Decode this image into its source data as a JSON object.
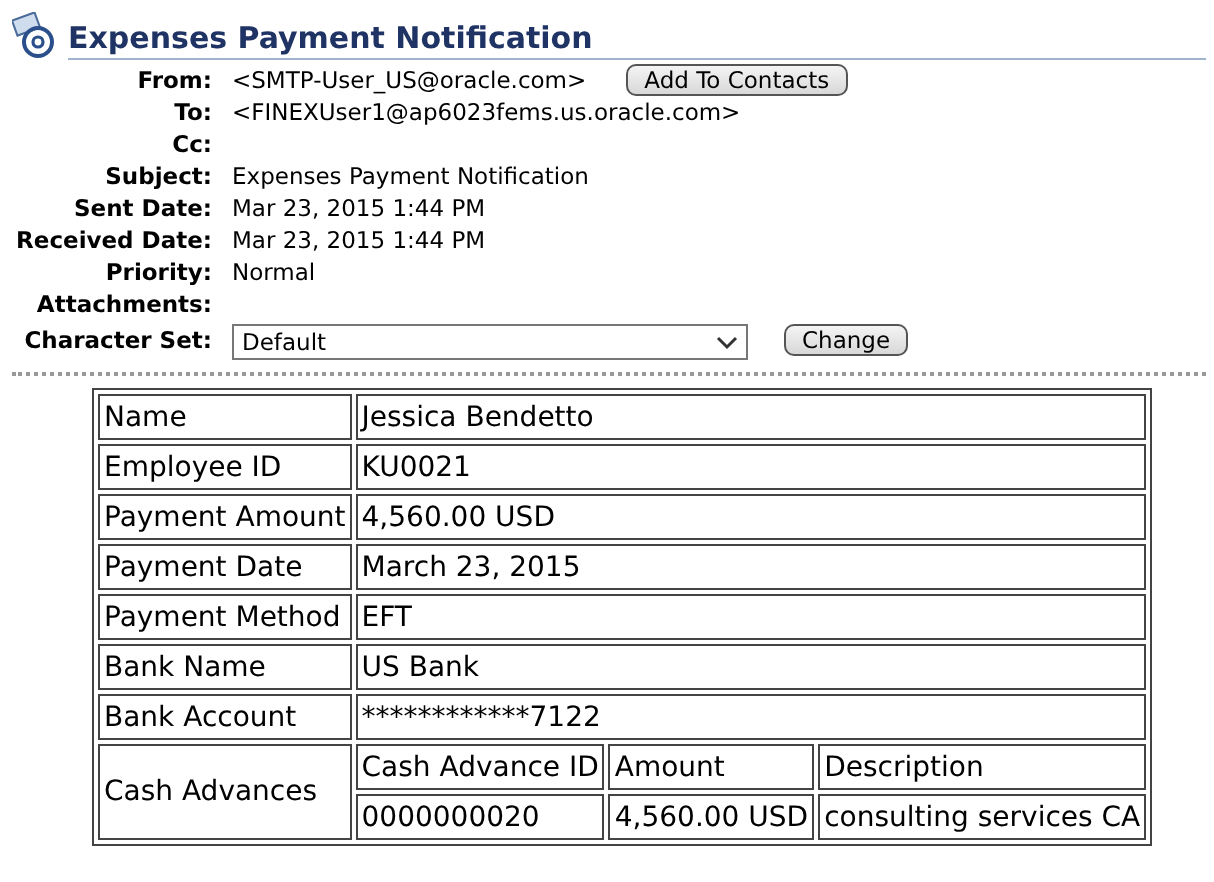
{
  "header": {
    "title": "Expenses Payment Notification"
  },
  "fields": [
    {
      "label": "From:",
      "value": "<SMTP-User_US@oracle.com>",
      "button": "Add To Contacts"
    },
    {
      "label": "To:",
      "value": "<FINEXUser1@ap6023fems.us.oracle.com>"
    },
    {
      "label": "Cc:"
    },
    {
      "label": "Subject:",
      "value": "Expenses Payment Notification"
    },
    {
      "label": "Sent Date:",
      "value": "Mar 23, 2015 1:44 PM"
    },
    {
      "label": "Received Date:",
      "value": "Mar 23, 2015 1:44 PM"
    },
    {
      "label": "Priority:",
      "value": "Normal"
    },
    {
      "label": "Attachments:"
    }
  ],
  "character_set": {
    "label": "Character Set:",
    "value": "Default",
    "button": "Change"
  },
  "details": [
    {
      "label": "Name",
      "value": "Jessica Bendetto"
    },
    {
      "label": "Employee ID",
      "value": "KU0021"
    },
    {
      "label": "Payment Amount",
      "value": "4,560.00 USD"
    },
    {
      "label": "Payment Date",
      "value": "March 23, 2015"
    },
    {
      "label": "Payment Method",
      "value": "EFT"
    },
    {
      "label": "Bank Name",
      "value": "US Bank"
    },
    {
      "label": "Bank Account",
      "value": "************7122"
    }
  ],
  "cash_advances": {
    "label": "Cash Advances",
    "columns": [
      "Cash Advance ID",
      "Amount",
      "Description"
    ],
    "rows": [
      [
        "0000000020",
        "4,560.00 USD",
        "consulting services CA"
      ]
    ]
  }
}
